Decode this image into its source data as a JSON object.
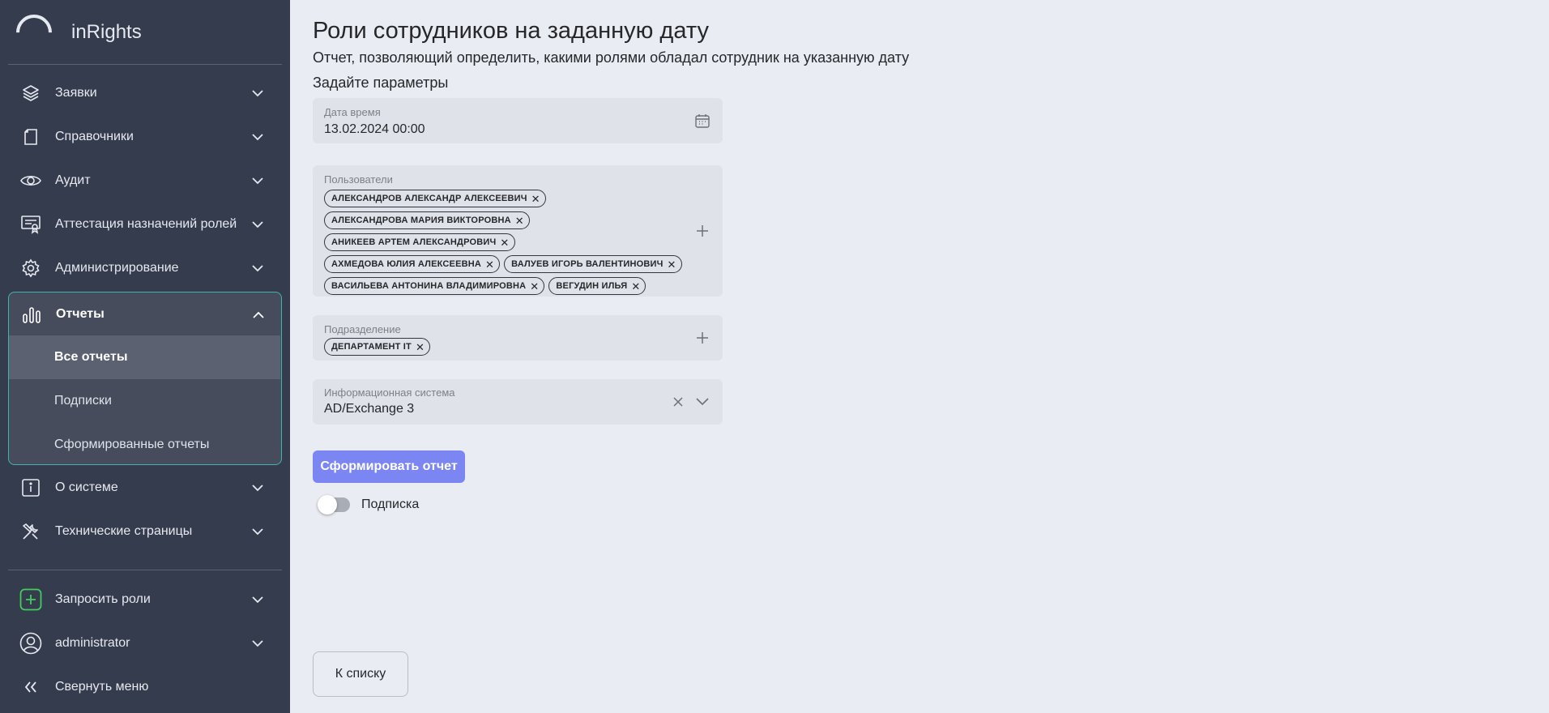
{
  "app": {
    "name": "inRights"
  },
  "sidebar": {
    "items": [
      {
        "label": "Заявки",
        "icon": "layers-icon"
      },
      {
        "label": "Справочники",
        "icon": "book-icon"
      },
      {
        "label": "Аудит",
        "icon": "eye-icon"
      },
      {
        "label": "Аттестация назначений ролей",
        "icon": "certificate-icon"
      },
      {
        "label": "Администрирование",
        "icon": "gear-icon"
      },
      {
        "label": "Отчеты",
        "icon": "bar-chart-icon"
      },
      {
        "label": "О системе",
        "icon": "info-icon"
      },
      {
        "label": "Технические страницы",
        "icon": "tools-icon"
      }
    ],
    "reports_sub": [
      "Все отчеты",
      "Подписки",
      "Сформированные отчеты"
    ],
    "request_roles": "Запросить роли",
    "user": "administrator",
    "collapse": "Свернуть меню"
  },
  "page": {
    "title": "Роли сотрудников на заданную дату",
    "subtitle": "Отчет, позволяющий определить, какими ролями обладал сотрудник на указанную дату",
    "params_label": "Задайте параметры"
  },
  "form": {
    "datetime": {
      "label": "Дата время",
      "value": "13.02.2024 00:00"
    },
    "users": {
      "label": "Пользователи",
      "chips": [
        "АЛЕКСАНДРОВ АЛЕКСАНДР АЛЕКСЕЕВИЧ",
        "АЛЕКСАНДРОВА МАРИЯ ВИКТОРОВНА",
        "АНИКЕЕВ АРТЕМ АЛЕКСАНДРОВИЧ",
        "АХМЕДОВА ЮЛИЯ АЛЕКСЕЕВНА",
        "ВАЛУЕВ ИГОРЬ ВАЛЕНТИНОВИЧ",
        "ВАСИЛЬЕВА АНТОНИНА ВЛАДИМИРОВНА",
        "ВЕГУДИН ИЛЬЯ"
      ]
    },
    "department": {
      "label": "Подразделение",
      "chips": [
        "ДЕПАРТАМЕНТ IT"
      ]
    },
    "system": {
      "label": "Информационная система",
      "value": "AD/Exchange 3"
    },
    "submit": "Сформировать отчет",
    "subscription": {
      "label": "Подписка",
      "on": false
    },
    "back": "К списку"
  },
  "colors": {
    "sidebar": "#353c4e",
    "accent": "#7b86f3",
    "active_border": "#3fb3b0",
    "background": "#e9ecf2"
  }
}
